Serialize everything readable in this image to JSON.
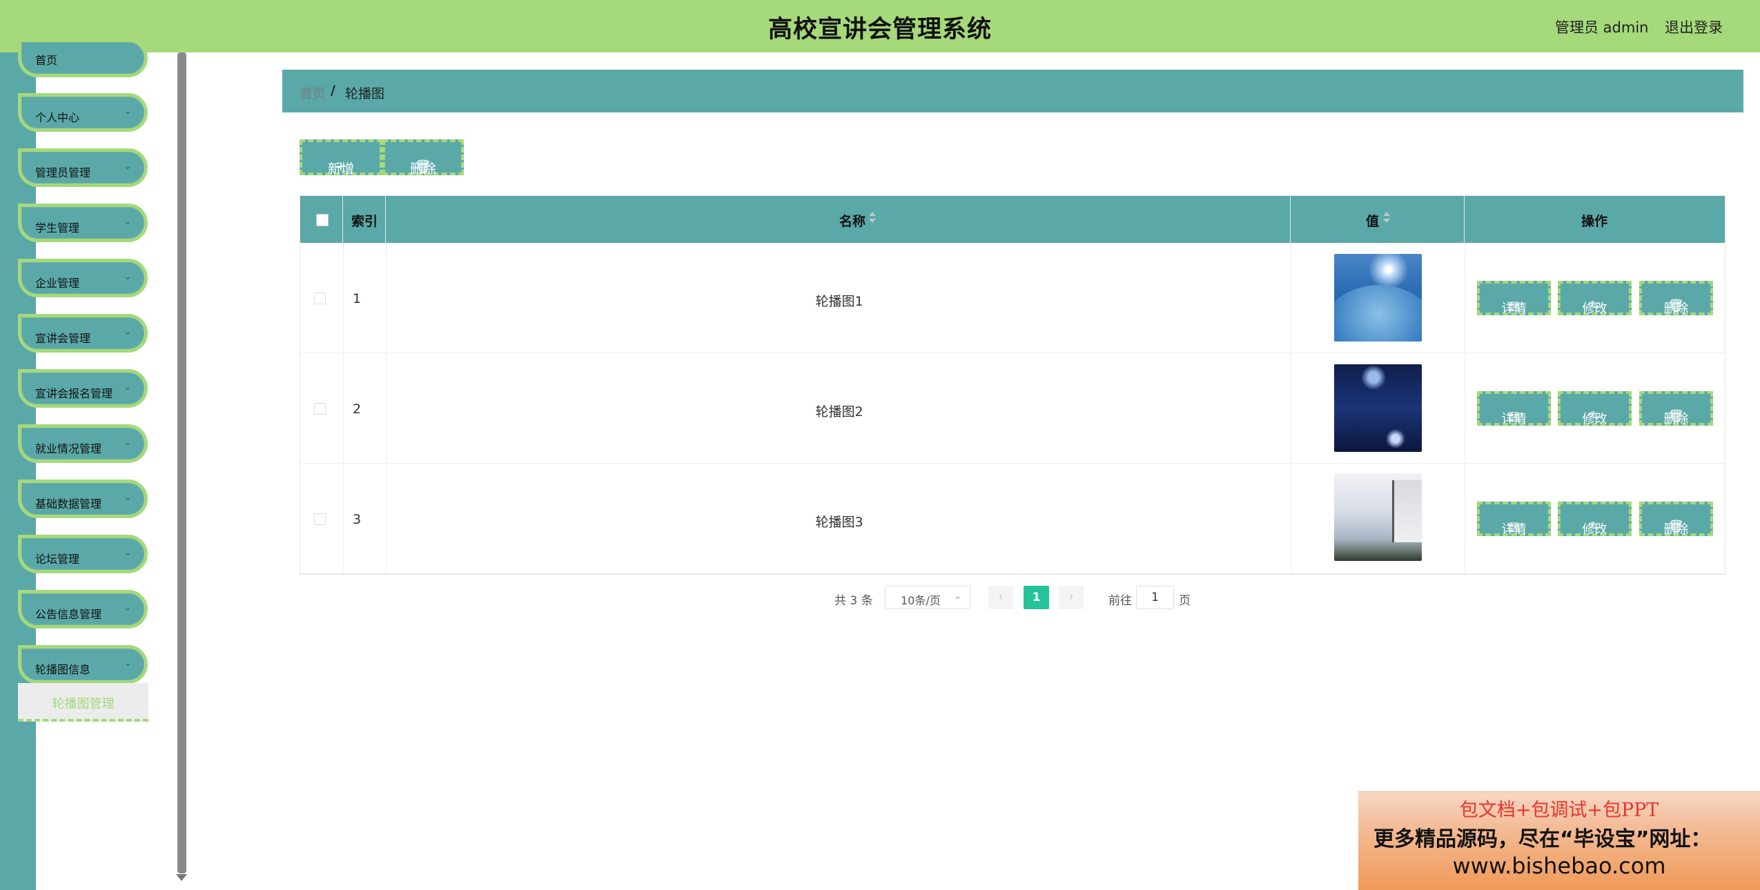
{
  "header": {
    "title": "高校宣讲会管理系统",
    "user_label": "管理员 admin",
    "logout_label": "退出登录",
    "bg_color": "#a5d97a"
  },
  "sidebar": {
    "items": [
      {
        "label": "首页"
      },
      {
        "label": "个人中心"
      },
      {
        "label": "管理员管理"
      },
      {
        "label": "学生管理"
      },
      {
        "label": "企业管理"
      },
      {
        "label": "宣讲会管理"
      },
      {
        "label": "宣讲会报名管理"
      },
      {
        "label": "就业情况管理"
      },
      {
        "label": "基础数据管理"
      },
      {
        "label": "论坛管理"
      },
      {
        "label": "公告信息管理"
      },
      {
        "label": "轮播图信息"
      }
    ],
    "active_sub": "轮播图管理",
    "accent_color": "#5ba8a8"
  },
  "breadcrumb": {
    "home": "首页",
    "separator": "/",
    "current": "轮播图"
  },
  "toolbar": {
    "add_label": "新增",
    "delete_label": "删除"
  },
  "table": {
    "columns": [
      "索引",
      "名称",
      "值",
      "操作"
    ],
    "rows": [
      {
        "index": "1",
        "name": "轮播图1",
        "image": "blue globe"
      },
      {
        "index": "2",
        "name": "轮播图2",
        "image": "dark space planet"
      },
      {
        "index": "3",
        "name": "轮播图3",
        "image": "misty village painting"
      }
    ],
    "actions": {
      "detail": "详情",
      "edit": "修改",
      "delete": "删除"
    }
  },
  "pagination": {
    "total": "共 3 条",
    "page_size": "10条/页",
    "current_page": "1",
    "goto_label": "前往",
    "goto_value": "1",
    "page_unit": "页"
  },
  "promo": {
    "line1": "包文档+包调试+包PPT",
    "line2": "更多精品源码，尽在“毕设宝”网址：",
    "line3": "www.bishebao.com"
  }
}
